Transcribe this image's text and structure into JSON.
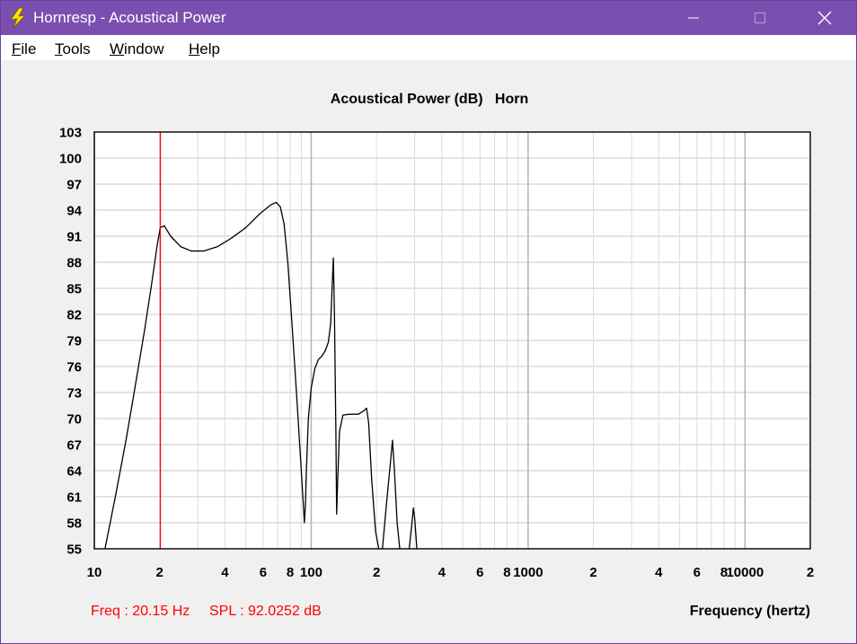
{
  "window": {
    "title": "Hornresp - Acoustical Power",
    "icon": "lightning-bolt-icon",
    "controls": [
      "minimize-icon",
      "maximize-icon",
      "close-icon"
    ]
  },
  "menu": [
    {
      "key": "F",
      "rest": "ile"
    },
    {
      "key": "T",
      "rest": "ools"
    },
    {
      "key": "W",
      "rest": "indow"
    },
    {
      "key": "H",
      "rest": "elp"
    }
  ],
  "status": {
    "freq": "Freq : 20.15 Hz",
    "spl": "SPL : 92.0252 dB"
  },
  "colors": {
    "titlebar": "#7b4fb0",
    "cursor": "#ff0000",
    "curve": "#000000",
    "grid": "#c8c8c8"
  },
  "chart_data": {
    "type": "line",
    "title": "Acoustical Power (dB)   Horn",
    "xlabel": "Frequency (hertz)",
    "ylabel": "",
    "x_scale": "log",
    "xlim": [
      10,
      20000
    ],
    "ylim": [
      55,
      103
    ],
    "grid": true,
    "y_ticks": [
      103,
      100,
      97,
      94,
      91,
      88,
      85,
      82,
      79,
      76,
      73,
      70,
      67,
      64,
      61,
      58,
      55
    ],
    "x_tick_labels": [
      {
        "value": 10,
        "label": "10"
      },
      {
        "value": 20,
        "label": "2"
      },
      {
        "value": 40,
        "label": "4"
      },
      {
        "value": 60,
        "label": "6"
      },
      {
        "value": 80,
        "label": "8"
      },
      {
        "value": 100,
        "label": "100"
      },
      {
        "value": 200,
        "label": "2"
      },
      {
        "value": 400,
        "label": "4"
      },
      {
        "value": 600,
        "label": "6"
      },
      {
        "value": 800,
        "label": "8"
      },
      {
        "value": 1000,
        "label": "1000"
      },
      {
        "value": 2000,
        "label": "2"
      },
      {
        "value": 4000,
        "label": "4"
      },
      {
        "value": 6000,
        "label": "6"
      },
      {
        "value": 8000,
        "label": "8"
      },
      {
        "value": 10000,
        "label": "10000"
      },
      {
        "value": 20000,
        "label": "2"
      }
    ],
    "cursor_freq": 20.15,
    "series": [
      {
        "points": [
          [
            11.2,
            55
          ],
          [
            12.5,
            61
          ],
          [
            14,
            67.5
          ],
          [
            15.5,
            74
          ],
          [
            17,
            80
          ],
          [
            18.5,
            86
          ],
          [
            19.5,
            90
          ],
          [
            20.15,
            92.0
          ],
          [
            21,
            92.2
          ],
          [
            22.5,
            91
          ],
          [
            25,
            89.8
          ],
          [
            28,
            89.3
          ],
          [
            32,
            89.3
          ],
          [
            37,
            89.8
          ],
          [
            43,
            90.8
          ],
          [
            50,
            92
          ],
          [
            58,
            93.6
          ],
          [
            65,
            94.6
          ],
          [
            69,
            94.9
          ],
          [
            72,
            94.4
          ],
          [
            75,
            92.4
          ],
          [
            78,
            88
          ],
          [
            81,
            82
          ],
          [
            84,
            76
          ],
          [
            87,
            70
          ],
          [
            90,
            64
          ],
          [
            92,
            60
          ],
          [
            93,
            58
          ],
          [
            94,
            60
          ],
          [
            95,
            64
          ],
          [
            97,
            70
          ],
          [
            100,
            73.5
          ],
          [
            104,
            75.8
          ],
          [
            108,
            76.8
          ],
          [
            112,
            77.2
          ],
          [
            116,
            77.8
          ],
          [
            120,
            78.8
          ],
          [
            123,
            81
          ],
          [
            125,
            85.5
          ],
          [
            126.5,
            88.5
          ],
          [
            128,
            82
          ],
          [
            130,
            68
          ],
          [
            131,
            59
          ],
          [
            132.5,
            63
          ],
          [
            135,
            68.5
          ],
          [
            140,
            70.4
          ],
          [
            150,
            70.5
          ],
          [
            165,
            70.5
          ],
          [
            175,
            70.9
          ],
          [
            180,
            71.2
          ],
          [
            184,
            69.5
          ],
          [
            190,
            63
          ],
          [
            198,
            57
          ],
          [
            205,
            55
          ]
        ]
      },
      {
        "points": [
          [
            213,
            55
          ],
          [
            222,
            60
          ],
          [
            232,
            65
          ],
          [
            237,
            67.5
          ],
          [
            242,
            64
          ],
          [
            249,
            58
          ],
          [
            256,
            55
          ]
        ]
      },
      {
        "points": [
          [
            283,
            55
          ],
          [
            290,
            57.5
          ],
          [
            296,
            59.7
          ],
          [
            300,
            58.5
          ],
          [
            307,
            55
          ]
        ]
      }
    ]
  }
}
